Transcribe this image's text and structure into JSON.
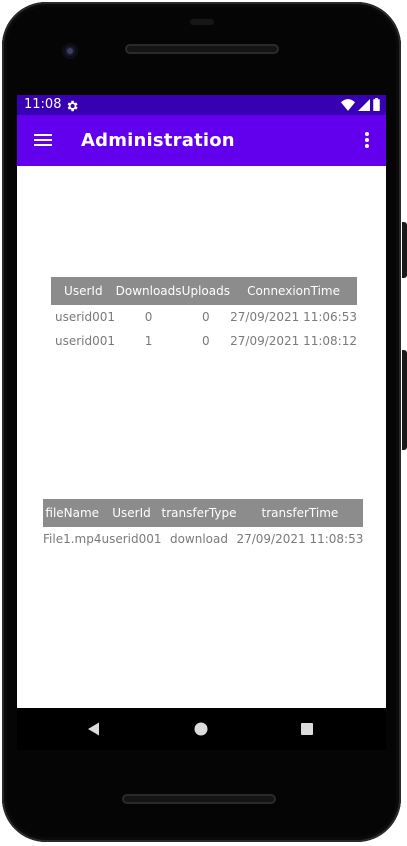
{
  "status_bar": {
    "time": "11:08"
  },
  "app_bar": {
    "title": "Administration"
  },
  "users_table": {
    "headers": [
      "UserId",
      "Downloads",
      "Uploads",
      "ConnexionTime"
    ],
    "rows": [
      [
        "userid001",
        "0",
        "0",
        "27/09/2021 11:06:53"
      ],
      [
        "userid001",
        "1",
        "0",
        "27/09/2021 11:08:12"
      ]
    ]
  },
  "transfers_table": {
    "headers": [
      "fileName",
      "UserId",
      "transferType",
      "transferTime"
    ],
    "rows": [
      [
        "File1.mp4",
        "userid001",
        "download",
        "27/09/2021 11:08:53"
      ]
    ]
  },
  "icons": {
    "status": [
      "gear-icon",
      "wifi-icon",
      "signal-icon",
      "battery-icon"
    ],
    "app_bar": [
      "hamburger-menu-icon",
      "more-vert-icon"
    ],
    "navigation": [
      "back-icon",
      "home-icon",
      "recents-icon"
    ]
  },
  "colors": {
    "status_bar": "#3700b3",
    "app_bar": "#6200ee",
    "table_header": "#8c8c8c",
    "table_text": "#7a7a7a"
  }
}
